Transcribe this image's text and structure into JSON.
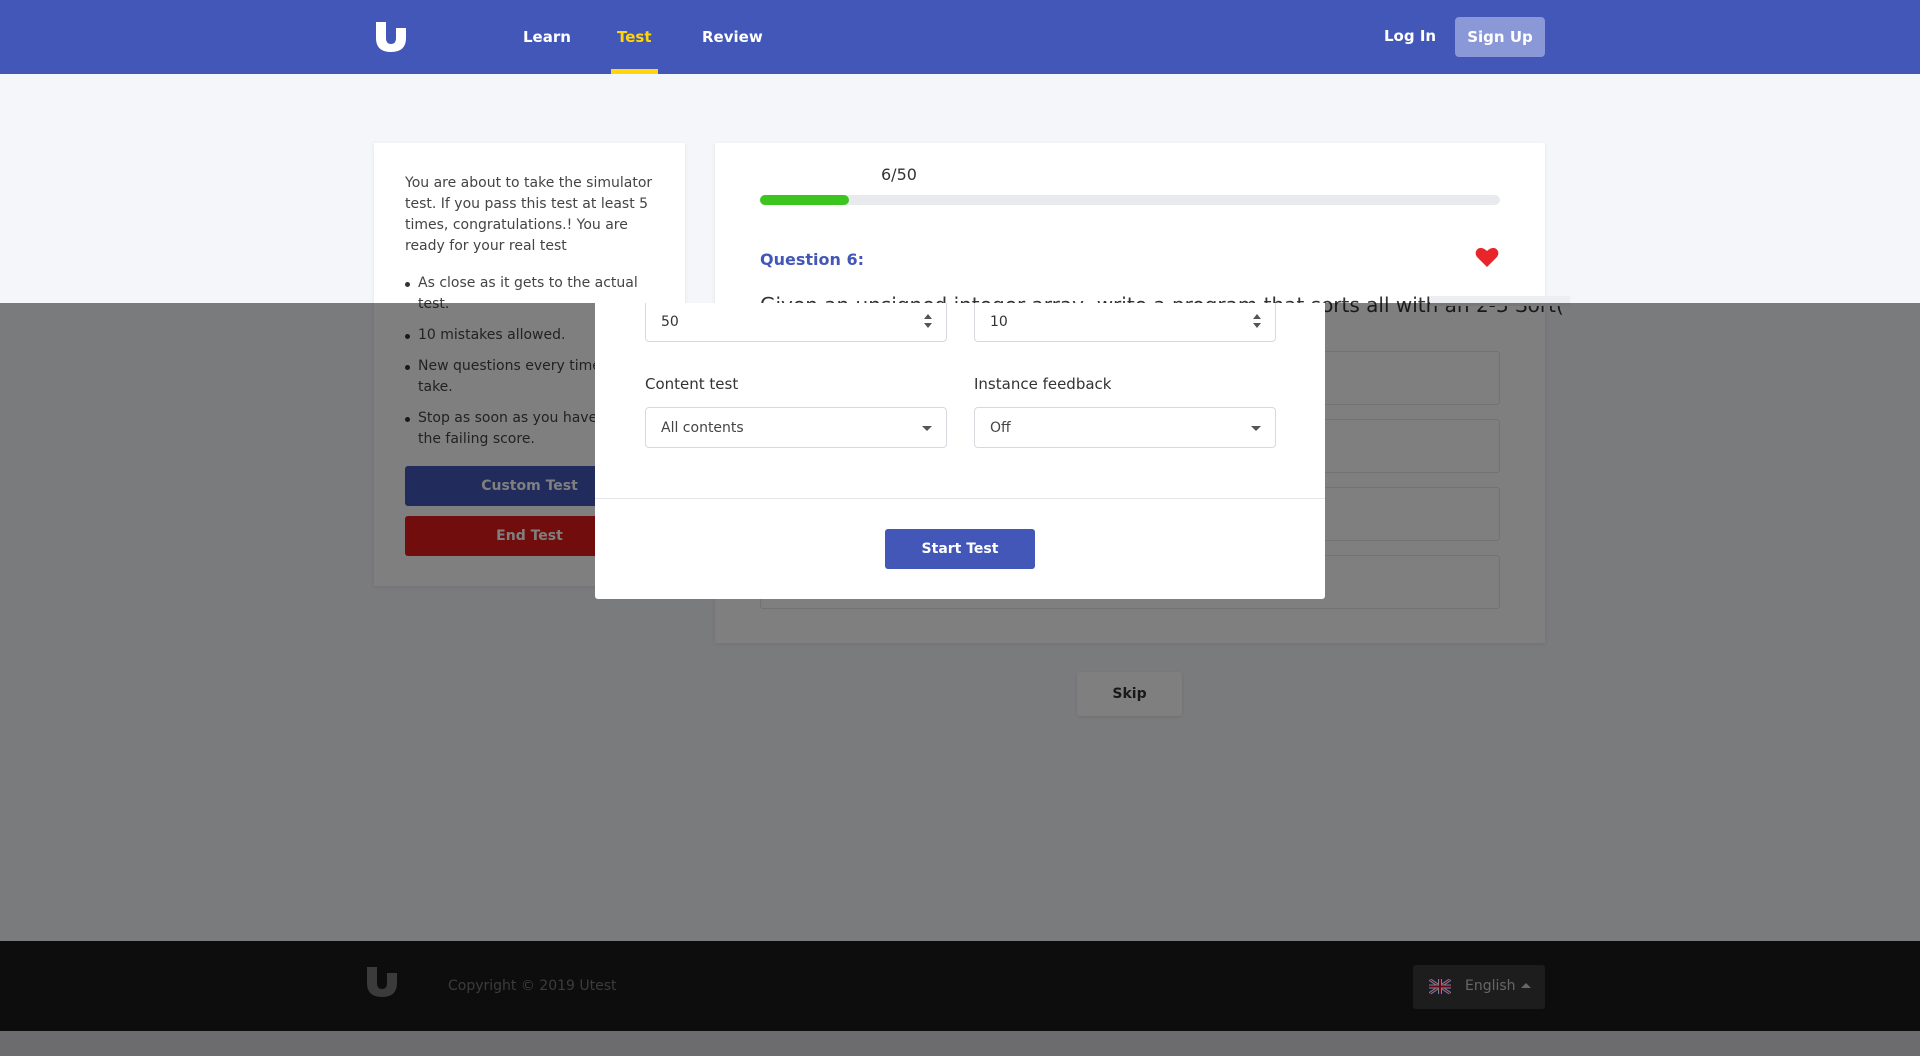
{
  "header": {
    "logo_icon": "utest-logo",
    "nav": [
      {
        "label": "Learn"
      },
      {
        "label": "Test",
        "active": true
      },
      {
        "label": "Review"
      }
    ],
    "login_label": "Log In",
    "signup_label": "Sign Up"
  },
  "sidebar": {
    "intro": "You are about to take the simulator test. If you pass this test at least 5 times, congratulations.! You are ready for your real test",
    "bullets": [
      "As close as it gets to the actual test.",
      "10 mistakes allowed.",
      "New questions every time you take.",
      "Stop as soon as you have reached the failing score."
    ],
    "custom_test_label": "Custom Test",
    "end_test_label": "End Test"
  },
  "quiz": {
    "progress_text": "6/50",
    "progress_fraction": 0.12,
    "question_label": "Question 6:",
    "favorite_icon": "heart-icon",
    "question_text": "Given an unsigned integer array, write a program that sorts all with an 2-3 Sort(",
    "skip_label": "Skip"
  },
  "modal": {
    "questions_count": "50",
    "mistakes_count": "10",
    "content_test_label": "Content test",
    "content_test_value": "All contents",
    "instance_feedback_label": "Instance feedback",
    "instance_feedback_value": "Off",
    "start_label": "Start Test"
  },
  "footer": {
    "copyright": "Copyright © 2019 Utest",
    "language": "English",
    "flag_icon": "uk-flag-icon"
  },
  "colors": {
    "brand": "#4257b8",
    "active_nav": "#ffd60a",
    "progress": "#3cc51e",
    "danger": "#e21b1b",
    "favorite": "#e8262a"
  }
}
